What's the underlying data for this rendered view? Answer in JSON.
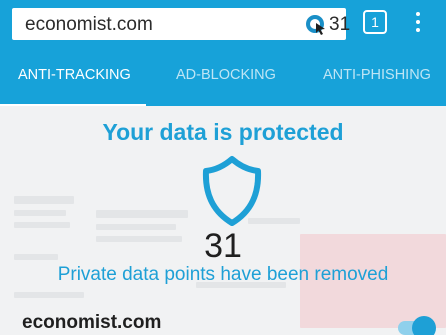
{
  "browser": {
    "url": "economist.com",
    "tracker_count": "31",
    "tabs_count": "1",
    "ghost_icon": "ghostery-icon",
    "menu_icon": "more-vert-icon"
  },
  "tabs": [
    {
      "label": "ANTI-TRACKING",
      "active": true
    },
    {
      "label": "AD-BLOCKING",
      "active": false
    },
    {
      "label": "ANTI-PHISHING",
      "active": false
    }
  ],
  "panel": {
    "headline": "Your data is protected",
    "shield_icon": "shield-icon",
    "count": "31",
    "subline": "Private data points have been removed",
    "site": "economist.com",
    "toggle_on": true
  },
  "colors": {
    "brand": "#17a2d9",
    "accent": "#1ea0d6",
    "toggle_track": "#8fd0ec"
  }
}
